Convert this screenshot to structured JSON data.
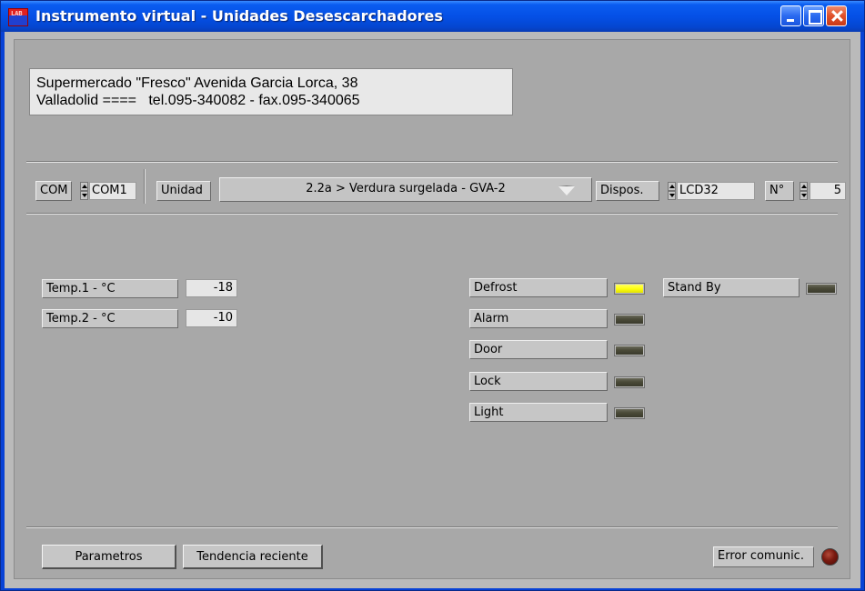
{
  "window": {
    "title": "Instrumento virtual - Unidades Desescarchadores",
    "app_icon_text": "LAB"
  },
  "header": {
    "line1": "Supermercado \"Fresco\" Avenida Garcia Lorca, 38",
    "line2": "Valladolid ====   tel.095-340082 - fax.095-340065"
  },
  "config": {
    "com_label": "COM",
    "com_value": "COM1",
    "unidad_label": "Unidad",
    "unidad_value": "2.2a > Verdura surgelada - GVA-2",
    "dispos_label": "Dispos.",
    "dispos_value": "LCD32",
    "n_label": "N°",
    "n_value": "5"
  },
  "temps": [
    {
      "label": "Temp.1 - °C",
      "value": "-18"
    },
    {
      "label": "Temp.2 - °C",
      "value": "-10"
    }
  ],
  "indicators": [
    {
      "label": "Defrost",
      "on": true
    },
    {
      "label": "Alarm",
      "on": false
    },
    {
      "label": "Door",
      "on": false
    },
    {
      "label": "Lock",
      "on": false
    },
    {
      "label": "Light",
      "on": false
    }
  ],
  "standby": {
    "label": "Stand By",
    "on": false
  },
  "footer": {
    "parametros_label": "Parametros",
    "tendencia_label": "Tendencia reciente",
    "error_label": "Error comunic."
  },
  "colors": {
    "led_on": "#ffff10",
    "led_off": "#4a4a38",
    "error_led": "#7a1a10",
    "titlebar": "#0550e6"
  },
  "icons": [
    "app-icon",
    "minimize-icon",
    "maximize-icon",
    "close-icon",
    "spinner-icon",
    "dropdown-arrow-icon"
  ]
}
